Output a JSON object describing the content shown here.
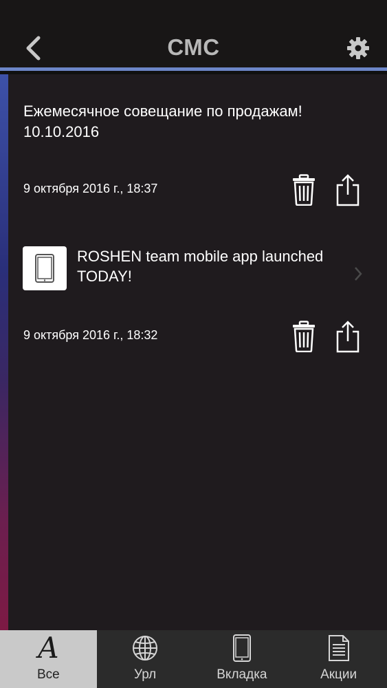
{
  "header": {
    "title": "СМС",
    "back_icon": "chevron-left-icon",
    "settings_icon": "gear-icon",
    "accent_color": "#6c86c7"
  },
  "messages": [
    {
      "text_line1": "Ежемесячное совещание по продажам!",
      "text_line2": "10.10.2016",
      "date": "9 октября 2016 г., 18:37",
      "actions": [
        "trash-icon",
        "share-icon"
      ]
    },
    {
      "link_line1": "ROSHEN team mobile app launched",
      "link_line2": "TODAY!",
      "thumb_icon": "tablet-icon",
      "date": "9 октября 2016 г., 18:32",
      "actions": [
        "trash-icon",
        "share-icon"
      ]
    }
  ],
  "tabs": [
    {
      "label": "Все",
      "icon": "letter-a-icon",
      "icon_text": "A",
      "active": true
    },
    {
      "label": "Урл",
      "icon": "globe-icon",
      "active": false
    },
    {
      "label": "Вкладка",
      "icon": "tablet-icon",
      "active": false
    },
    {
      "label": "Акции",
      "icon": "document-icon",
      "active": false
    }
  ]
}
